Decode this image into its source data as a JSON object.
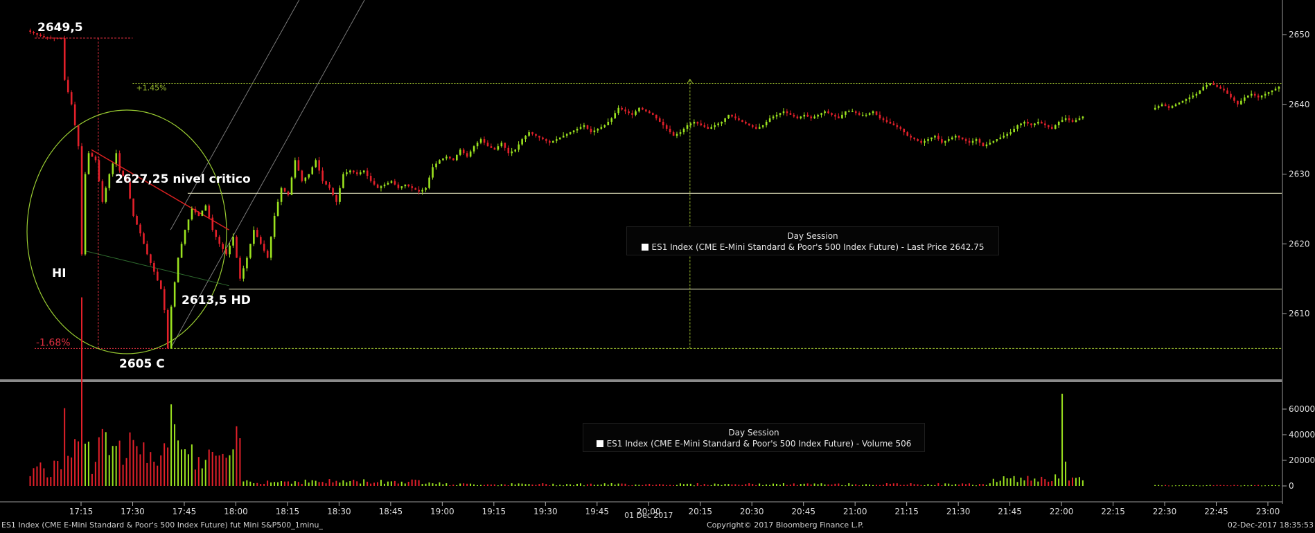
{
  "colors": {
    "background": "#000000",
    "up_candle": "#9be21f",
    "down_candle": "#e3202a",
    "volume_up": "#9be21f",
    "volume_down": "#e3202a",
    "support_lines": "#f0f0c8",
    "dotted_green": "#9bbd2e",
    "dotted_red": "#e03040",
    "circle": "#9acd32",
    "trendline_red": "#d82020",
    "channel": "#7a7a7a",
    "axis_text": "#dddddd"
  },
  "chart_data": [
    {
      "type": "candlestick",
      "name": "ES1 Index price",
      "ylim": [
        2603,
        2654
      ],
      "yticks": [
        2610,
        2620,
        2630,
        2640,
        2650
      ],
      "x_range_minutes": [
        1020,
        1380
      ],
      "xtick_minutes": [
        1035,
        1050,
        1065,
        1080,
        1095,
        1110,
        1125,
        1140,
        1155,
        1170,
        1185,
        1200,
        1215,
        1230,
        1245,
        1260,
        1275,
        1290,
        1305,
        1320,
        1335,
        1350,
        1365,
        1380
      ],
      "xtick_labels": [
        "17:15",
        "17:30",
        "17:45",
        "18:00",
        "18:15",
        "18:30",
        "18:45",
        "19:00",
        "19:15",
        "19:30",
        "19:45",
        "20:00",
        "20:15",
        "20:30",
        "20:45",
        "21:00",
        "21:15",
        "21:30",
        "21:45",
        "22:00",
        "22:15",
        "22:30",
        "22:45",
        "23:00"
      ],
      "path_points": [
        [
          1020,
          2650.6
        ],
        [
          1025,
          2649.6
        ],
        [
          1030,
          2649.5
        ],
        [
          1031,
          2643.5
        ],
        [
          1033,
          2640
        ],
        [
          1035,
          2634
        ],
        [
          1036,
          2618.5
        ],
        [
          1037,
          2630
        ],
        [
          1038,
          2633
        ],
        [
          1040,
          2632
        ],
        [
          1042,
          2626
        ],
        [
          1044,
          2630
        ],
        [
          1046,
          2633
        ],
        [
          1047,
          2630.5
        ],
        [
          1049,
          2629
        ],
        [
          1051,
          2624
        ],
        [
          1053,
          2621.5
        ],
        [
          1055,
          2618.5
        ],
        [
          1057,
          2616
        ],
        [
          1059,
          2613.5
        ],
        [
          1060,
          2610.5
        ],
        [
          1061,
          2605
        ],
        [
          1062,
          2611
        ],
        [
          1064,
          2618
        ],
        [
          1066,
          2622
        ],
        [
          1068,
          2625
        ],
        [
          1070,
          2624
        ],
        [
          1072,
          2625.5
        ],
        [
          1074,
          2622
        ],
        [
          1076,
          2620
        ],
        [
          1078,
          2618.5
        ],
        [
          1080,
          2621
        ],
        [
          1082,
          2615
        ],
        [
          1084,
          2618
        ],
        [
          1086,
          2622
        ],
        [
          1088,
          2620
        ],
        [
          1090,
          2618
        ],
        [
          1092,
          2624
        ],
        [
          1094,
          2628
        ],
        [
          1096,
          2627
        ],
        [
          1098,
          2632
        ],
        [
          1100,
          2629
        ],
        [
          1102,
          2630
        ],
        [
          1104,
          2632
        ],
        [
          1106,
          2629
        ],
        [
          1108,
          2628
        ],
        [
          1110,
          2626
        ],
        [
          1112,
          2630
        ],
        [
          1114,
          2630.5
        ],
        [
          1116,
          2630
        ],
        [
          1118,
          2630.5
        ],
        [
          1120,
          2629
        ],
        [
          1122,
          2628
        ],
        [
          1124,
          2628.5
        ],
        [
          1126,
          2629
        ],
        [
          1128,
          2628
        ],
        [
          1130,
          2628.5
        ],
        [
          1132,
          2628
        ],
        [
          1134,
          2627.5
        ],
        [
          1136,
          2628
        ],
        [
          1138,
          2631
        ],
        [
          1140,
          2632
        ],
        [
          1142,
          2632.5
        ],
        [
          1144,
          2632
        ],
        [
          1146,
          2633.5
        ],
        [
          1148,
          2632.5
        ],
        [
          1150,
          2634
        ],
        [
          1152,
          2635
        ],
        [
          1154,
          2634
        ],
        [
          1156,
          2633.5
        ],
        [
          1158,
          2634.5
        ],
        [
          1160,
          2633
        ],
        [
          1162,
          2633.5
        ],
        [
          1164,
          2635
        ],
        [
          1166,
          2636
        ],
        [
          1168,
          2635.5
        ],
        [
          1170,
          2635
        ],
        [
          1172,
          2634.5
        ],
        [
          1174,
          2635
        ],
        [
          1176,
          2635.5
        ],
        [
          1178,
          2636
        ],
        [
          1180,
          2636.5
        ],
        [
          1182,
          2637
        ],
        [
          1184,
          2636
        ],
        [
          1186,
          2636.5
        ],
        [
          1188,
          2637
        ],
        [
          1190,
          2638
        ],
        [
          1192,
          2639.5
        ],
        [
          1194,
          2639
        ],
        [
          1196,
          2638.5
        ],
        [
          1198,
          2639.5
        ],
        [
          1200,
          2639
        ],
        [
          1202,
          2638.5
        ],
        [
          1204,
          2637.5
        ],
        [
          1206,
          2636.5
        ],
        [
          1208,
          2635.5
        ],
        [
          1210,
          2636
        ],
        [
          1212,
          2637
        ],
        [
          1214,
          2637.5
        ],
        [
          1216,
          2637
        ],
        [
          1218,
          2636.5
        ],
        [
          1220,
          2637
        ],
        [
          1222,
          2637.5
        ],
        [
          1224,
          2638.5
        ],
        [
          1226,
          2638
        ],
        [
          1228,
          2637.5
        ],
        [
          1230,
          2637
        ],
        [
          1232,
          2636.5
        ],
        [
          1234,
          2637
        ],
        [
          1236,
          2638
        ],
        [
          1238,
          2638.5
        ],
        [
          1240,
          2639
        ],
        [
          1242,
          2638.5
        ],
        [
          1244,
          2638
        ],
        [
          1246,
          2638.5
        ],
        [
          1248,
          2638
        ],
        [
          1250,
          2638.5
        ],
        [
          1252,
          2639
        ],
        [
          1254,
          2638.5
        ],
        [
          1256,
          2638
        ],
        [
          1258,
          2639
        ],
        [
          1260,
          2639
        ],
        [
          1262,
          2638.5
        ],
        [
          1264,
          2638.5
        ],
        [
          1266,
          2639
        ],
        [
          1268,
          2638
        ],
        [
          1270,
          2637.5
        ],
        [
          1272,
          2637
        ],
        [
          1274,
          2636.5
        ],
        [
          1276,
          2635.5
        ],
        [
          1278,
          2635
        ],
        [
          1280,
          2634.5
        ],
        [
          1282,
          2635
        ],
        [
          1284,
          2635.5
        ],
        [
          1286,
          2634.5
        ],
        [
          1288,
          2635
        ],
        [
          1290,
          2635.5
        ],
        [
          1292,
          2635
        ],
        [
          1294,
          2634.5
        ],
        [
          1296,
          2635
        ],
        [
          1298,
          2634
        ],
        [
          1300,
          2634.5
        ],
        [
          1302,
          2635
        ],
        [
          1304,
          2635.5
        ],
        [
          1306,
          2636
        ],
        [
          1308,
          2637
        ],
        [
          1310,
          2637.5
        ],
        [
          1312,
          2637
        ],
        [
          1314,
          2637.5
        ],
        [
          1316,
          2637
        ],
        [
          1318,
          2636.5
        ],
        [
          1320,
          2637.5
        ],
        [
          1322,
          2638
        ],
        [
          1324,
          2637.5
        ],
        [
          1326,
          2638
        ],
        [
          1328,
          2638.5
        ],
        [
          1330,
          2638
        ],
        [
          1332,
          2638.5
        ],
        [
          1334,
          2638
        ],
        [
          1336,
          2638.5
        ],
        [
          1338,
          2639
        ],
        [
          1340,
          2638.5
        ],
        [
          1342,
          2639
        ],
        [
          1344,
          2639.5
        ],
        [
          1346,
          2639
        ],
        [
          1348,
          2639.5
        ],
        [
          1350,
          2640
        ],
        [
          1352,
          2639.5
        ],
        [
          1354,
          2640
        ],
        [
          1356,
          2640.5
        ],
        [
          1358,
          2641
        ],
        [
          1360,
          2641.5
        ],
        [
          1362,
          2642.5
        ],
        [
          1364,
          2643
        ],
        [
          1366,
          2642.5
        ],
        [
          1368,
          2642
        ],
        [
          1370,
          2641
        ],
        [
          1372,
          2640
        ],
        [
          1374,
          2641
        ],
        [
          1376,
          2641.5
        ],
        [
          1378,
          2641
        ],
        [
          1380,
          2641.5
        ],
        [
          1382,
          2642
        ],
        [
          1384,
          2642.5
        ],
        [
          1386,
          2642
        ],
        [
          1388,
          2642.5
        ],
        [
          1390,
          2642
        ],
        [
          1392,
          2643
        ],
        [
          1394,
          2643.5
        ],
        [
          1396,
          2643
        ],
        [
          1398,
          2644
        ],
        [
          1400,
          2644
        ],
        [
          1402,
          2644.5
        ],
        [
          1404,
          2644
        ],
        [
          1406,
          2644.5
        ],
        [
          1408,
          2644.5
        ],
        [
          1410,
          2644
        ],
        [
          1412,
          2644.5
        ],
        [
          1414,
          2644.3
        ],
        [
          1416,
          2644.5
        ],
        [
          1418,
          2644.2
        ],
        [
          1420,
          2644.4
        ],
        [
          1422,
          2644.5
        ],
        [
          1424,
          2644
        ],
        [
          1426,
          2643.5
        ],
        [
          1428,
          2642
        ],
        [
          1430,
          2642.5
        ],
        [
          1432,
          2643
        ]
      ],
      "gap_minutes": [
        1326,
        1347
      ],
      "levels": [
        {
          "value": 2627.25,
          "label": "2627,25 nivel critico"
        },
        {
          "value": 2613.5,
          "label": "2613,5 HD"
        },
        {
          "value": 2605,
          "label": "2605 C"
        }
      ],
      "high": {
        "value": 2649.5,
        "label": "2649,5"
      },
      "pct_up": {
        "value": 2643,
        "label": "+1.45%"
      },
      "pct_down": {
        "value": 2605,
        "label": "-1.68%"
      },
      "hi_label": "HI",
      "legend": {
        "title": "Day Session",
        "entry": "ES1 Index (CME E-Mini Standard & Poor's 500 Index Future) - Last Price 2642.75"
      }
    },
    {
      "type": "bar",
      "name": "ES1 Index volume",
      "ylim": [
        -5000,
        75000
      ],
      "yticks": [
        0,
        20000,
        40000,
        60000
      ],
      "spike": {
        "minute": 1320,
        "value": 72000
      },
      "legend": {
        "title": "Day Session",
        "entry": "ES1 Index (CME E-Mini Standard & Poor's 500 Index Future) - Volume 506"
      }
    }
  ],
  "xaxis": {
    "date_label": "01 Dec 2017"
  },
  "footer": {
    "left": "ES1 Index (CME E-Mini Standard & Poor's 500 Index Future) fut Mini S&P500_1minu_",
    "center": "Copyright© 2017 Bloomberg Finance L.P.",
    "right": "02-Dec-2017 18:35:53"
  }
}
